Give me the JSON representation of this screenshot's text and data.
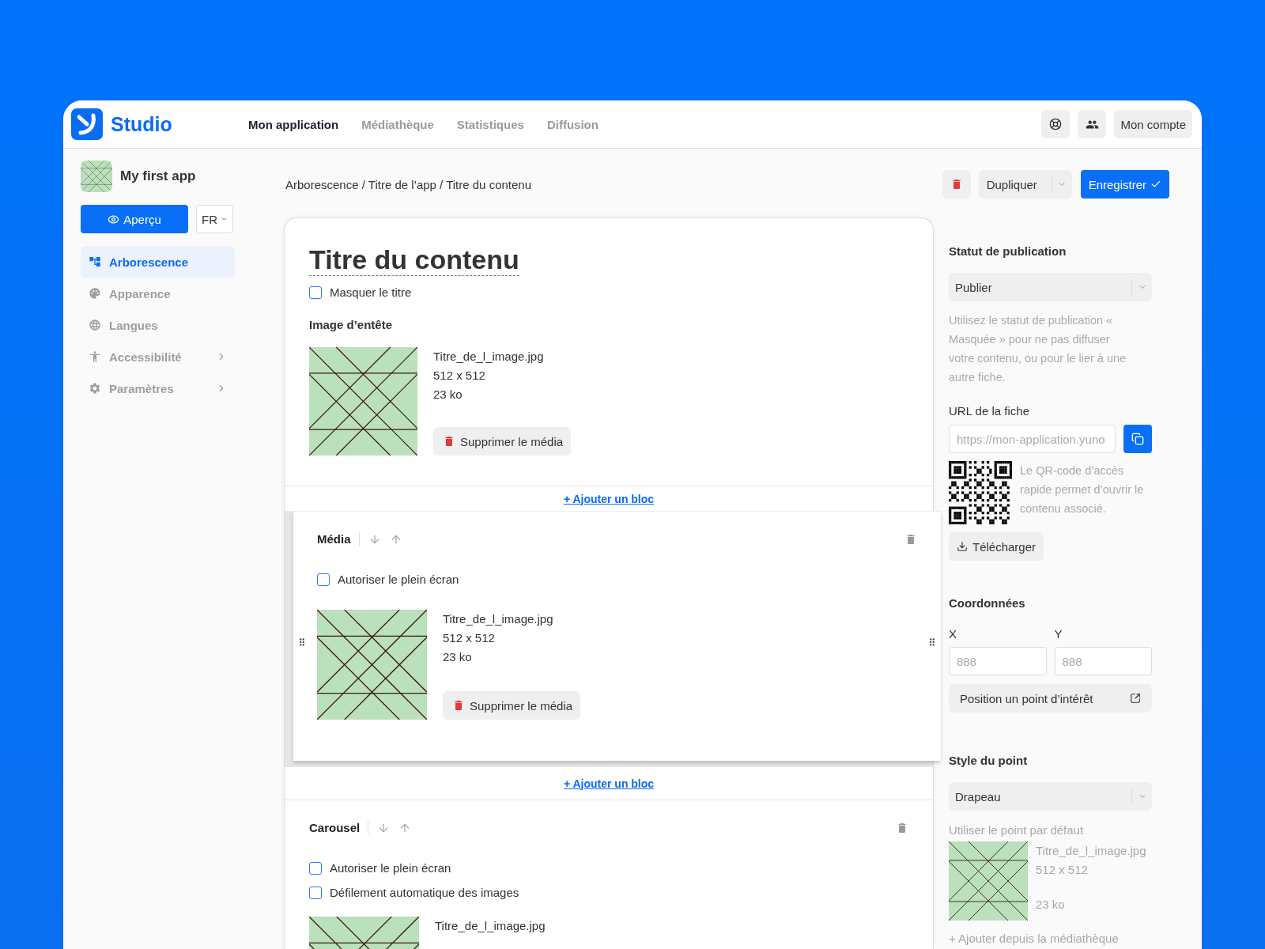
{
  "header": {
    "brand": "Studio",
    "nav": [
      {
        "label": "Mon application",
        "selected": true
      },
      {
        "label": "Médiathèque",
        "selected": false
      },
      {
        "label": "Statistiques",
        "selected": false
      },
      {
        "label": "Diffusion",
        "selected": false
      }
    ],
    "account": "Mon compte"
  },
  "sidebar": {
    "app_name": "My first app",
    "preview_button": "Aperçu",
    "language": "FR",
    "items": [
      {
        "label": "Arborescence",
        "selected": true,
        "expandable": false
      },
      {
        "label": "Apparence",
        "selected": false,
        "expandable": false
      },
      {
        "label": "Langues",
        "selected": false,
        "expandable": false
      },
      {
        "label": "Accessibilité",
        "selected": false,
        "expandable": true
      },
      {
        "label": "Paramètres",
        "selected": false,
        "expandable": true
      }
    ]
  },
  "toolbar": {
    "breadcrumb": "Arborescence / Titre de l’app / Titre du contenu",
    "duplicate": "Dupliquer",
    "save": "Enregistrer"
  },
  "content": {
    "title": "Titre du contenu",
    "hide_title": {
      "label": "Masquer le titre",
      "checked": false
    },
    "header_image": {
      "label": "Image d’entête",
      "name": "Titre_de_l_image.jpg",
      "size": "512 x 512",
      "weight": "23 ko",
      "delete": "Supprimer le média"
    },
    "blocks": [
      {
        "kind": "media",
        "add_before": "+ Ajouter un bloc",
        "title": "Média",
        "dragging": true,
        "options": [
          {
            "label": "Autoriser le plein écran",
            "checked": false
          }
        ],
        "file": {
          "name": "Titre_de_l_image.jpg",
          "size": "512 x 512",
          "weight": "23 ko",
          "delete": "Supprimer le média"
        }
      },
      {
        "kind": "carousel",
        "add_before": "+ Ajouter un bloc",
        "title": "Carousel",
        "dragging": false,
        "options": [
          {
            "label": "Autoriser le plein écran",
            "checked": false
          },
          {
            "label": "Défilement automatique des images",
            "checked": false
          }
        ],
        "file": {
          "name": "Titre_de_l_image.jpg"
        }
      }
    ]
  },
  "panel": {
    "publication": {
      "heading": "Statut de publication",
      "value": "Publier",
      "help": "Utilisez le statut de publication « Masquée » pour ne pas diffuser votre contenu, ou pour le lier à une autre fiche."
    },
    "url": {
      "label": "URL de la fiche",
      "placeholder": "https://mon-application.yuno"
    },
    "qr": {
      "text": "Le QR-code d’accès rapide permet d’ouvrir le contenu associé.",
      "download": "Télécharger"
    },
    "coordinates": {
      "heading": "Coordonnées",
      "x": {
        "label": "X",
        "placeholder": "888"
      },
      "y": {
        "label": "Y",
        "placeholder": "888"
      },
      "button": "Position un point d’intérêt"
    },
    "point_style": {
      "heading": "Style du point",
      "value": "Drapeau",
      "default_option": "Utiliser le point par défaut",
      "disabled": true,
      "file": {
        "name": "Titre_de_l_image.jpg",
        "size": "512 x 512",
        "weight": "23 ko"
      },
      "add_link": "+ Ajouter depuis la médiathèque"
    }
  }
}
